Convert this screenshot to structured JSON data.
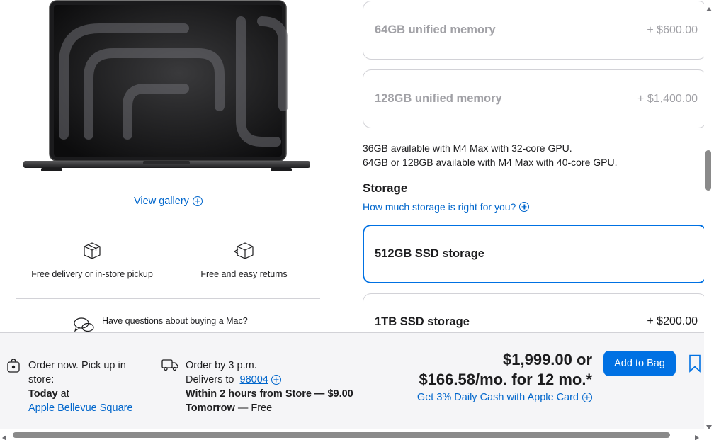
{
  "gallery": {
    "view_label": "View gallery",
    "icon": "plus-circle-icon"
  },
  "features": [
    {
      "label": "Free delivery or in-store pickup",
      "icon": "box-icon"
    },
    {
      "label": "Free and easy returns",
      "icon": "return-box-icon"
    }
  ],
  "questions": {
    "label": "Have questions about buying a Mac?",
    "icon": "chat-bubbles-icon"
  },
  "memory": {
    "options": [
      {
        "name": "64GB unified memory",
        "price": "+ $600.00",
        "state": "disabled"
      },
      {
        "name": "128GB unified memory",
        "price": "+ $1,400.00",
        "state": "disabled"
      }
    ],
    "note_line1": "36GB available with M4 Max with 32-core GPU.",
    "note_line2": "64GB or 128GB available with M4 Max with 40-core GPU."
  },
  "storage": {
    "title": "Storage",
    "help_link": "How much storage is right for you?",
    "options": [
      {
        "name": "512GB SSD storage",
        "price": "",
        "state": "selected"
      },
      {
        "name": "1TB SSD storage",
        "price": "+ $200.00",
        "state": "available"
      }
    ]
  },
  "order_bar": {
    "pickup": {
      "icon": "shopping-bag-icon",
      "line1": "Order now. Pick up in",
      "line2": "store:",
      "when_bold": "Today",
      "when_rest": " at",
      "store_link": "Apple Bellevue Square"
    },
    "delivery": {
      "icon": "delivery-truck-icon",
      "line1": "Order by 3 p.m.",
      "delivers_to": "Delivers to ",
      "zip": "98004",
      "option1": "Within 2 hours from Store — $9.00",
      "option2_bold": "Tomorrow",
      "option2_rest": " — Free"
    },
    "price": {
      "line1": "$1,999.00 or",
      "line2": "$166.58/mo. for 12 mo.*",
      "cash_link": "Get 3% Daily Cash with Apple Card"
    },
    "add_to_bag": "Add to Bag",
    "bookmark_icon": "bookmark-icon"
  },
  "colors": {
    "accent": "#0071e3",
    "link": "#0066cc",
    "bar_bg": "#f5f5f7",
    "border": "#d2d2d7",
    "disabled_text": "#a1a1a6"
  }
}
